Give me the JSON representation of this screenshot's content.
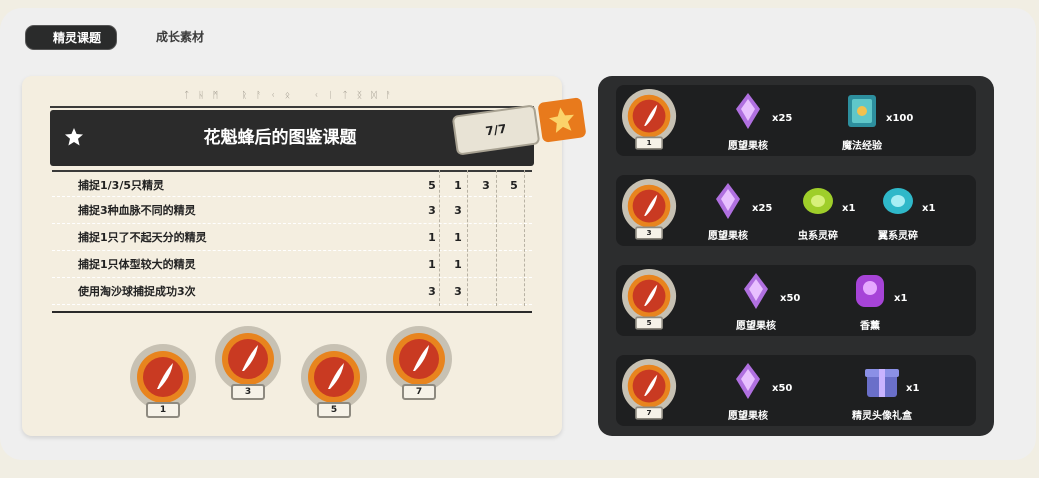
{
  "tabs": [
    {
      "label": "精灵课题",
      "active": true
    },
    {
      "label": "成长素材",
      "active": false
    }
  ],
  "card": {
    "rune_text": "ᛏᚺᛗ ᚱᚨᚲᛟ ᚲᛁᛏᛝᛞᚨ",
    "title": "花魁蜂后的图鉴课题",
    "progress": "7/7",
    "tasks": [
      {
        "desc": "捕捉1/3/5只精灵",
        "cols": [
          "5",
          "1",
          "3",
          "5"
        ]
      },
      {
        "desc": "捕捉3种血脉不同的精灵",
        "cols": [
          "3",
          "3",
          "",
          ""
        ]
      },
      {
        "desc": "捕捉1只了不起天分的精灵",
        "cols": [
          "1",
          "1",
          "",
          ""
        ]
      },
      {
        "desc": "捕捉1只体型较大的精灵",
        "cols": [
          "1",
          "1",
          "",
          ""
        ]
      },
      {
        "desc": "使用淘沙球捕捉成功3次",
        "cols": [
          "3",
          "3",
          "",
          ""
        ]
      }
    ],
    "badges": [
      "1",
      "3",
      "5",
      "7"
    ]
  },
  "rewards": [
    {
      "level": "1",
      "items": [
        {
          "name": "愿望果核",
          "qty": "x25",
          "icon": "wish-core-icon"
        },
        {
          "name": "魔法经验",
          "qty": "x100",
          "icon": "magic-book-icon"
        }
      ]
    },
    {
      "level": "3",
      "items": [
        {
          "name": "愿望果核",
          "qty": "x25",
          "icon": "wish-core-icon"
        },
        {
          "name": "虫系灵碎",
          "qty": "x1",
          "icon": "bug-shard-icon"
        },
        {
          "name": "翼系灵碎",
          "qty": "x1",
          "icon": "wing-shard-icon"
        }
      ]
    },
    {
      "level": "5",
      "items": [
        {
          "name": "愿望果核",
          "qty": "x50",
          "icon": "wish-core-icon"
        },
        {
          "name": "香薰",
          "qty": "x1",
          "icon": "aroma-icon"
        }
      ]
    },
    {
      "level": "7",
      "items": [
        {
          "name": "愿望果核",
          "qty": "x50",
          "icon": "wish-core-icon"
        },
        {
          "name": "精灵头像礼盒",
          "qty": "x1",
          "icon": "gift-box-icon"
        }
      ]
    }
  ],
  "colors": {
    "accent_orange": "#e87a1c",
    "dark": "#2b2b2b",
    "card_bg": "#f4eee0"
  }
}
